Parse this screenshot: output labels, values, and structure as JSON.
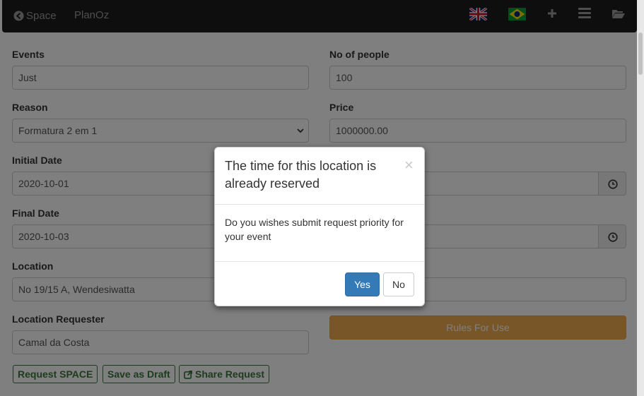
{
  "navbar": {
    "brand_label": "Space",
    "brand_icon": "arrow-circle-left-icon",
    "nav_link": "PlanOz",
    "icons": [
      "uk-flag-icon",
      "brazil-flag-icon",
      "plus-icon",
      "menu-icon",
      "folder-open-icon"
    ],
    "background": "#1c1c1c"
  },
  "form": {
    "events": {
      "label": "Events",
      "value": "Just"
    },
    "no_of_people": {
      "label": "No of people",
      "value": "100"
    },
    "reason": {
      "label": "Reason",
      "value": "Formatura 2 em 1"
    },
    "price": {
      "label": "Price",
      "value": "1000000.00"
    },
    "initial_date": {
      "label": "Initial Date",
      "value": "2020-10-01"
    },
    "final_date": {
      "label": "Final Date",
      "value": "2020-10-03"
    },
    "location": {
      "label": "Location",
      "value": "No 19/15 A, Wendesiwatta"
    },
    "location_requester": {
      "label": "Location Requester",
      "value": "Camal da Costa"
    },
    "rules_button": "Rules For Use",
    "actions": {
      "request": "Request SPACE",
      "draft": "Save as Draft",
      "share": "Share Request"
    }
  },
  "modal": {
    "title": "The time for this location is already reserved",
    "close_glyph": "×",
    "body": "Do you wishes submit request priority for your event",
    "yes_label": "Yes",
    "no_label": "No"
  },
  "colors": {
    "primary": "#337ab7",
    "warning": "#f0ad4e",
    "success_outline": "#3c763d"
  }
}
